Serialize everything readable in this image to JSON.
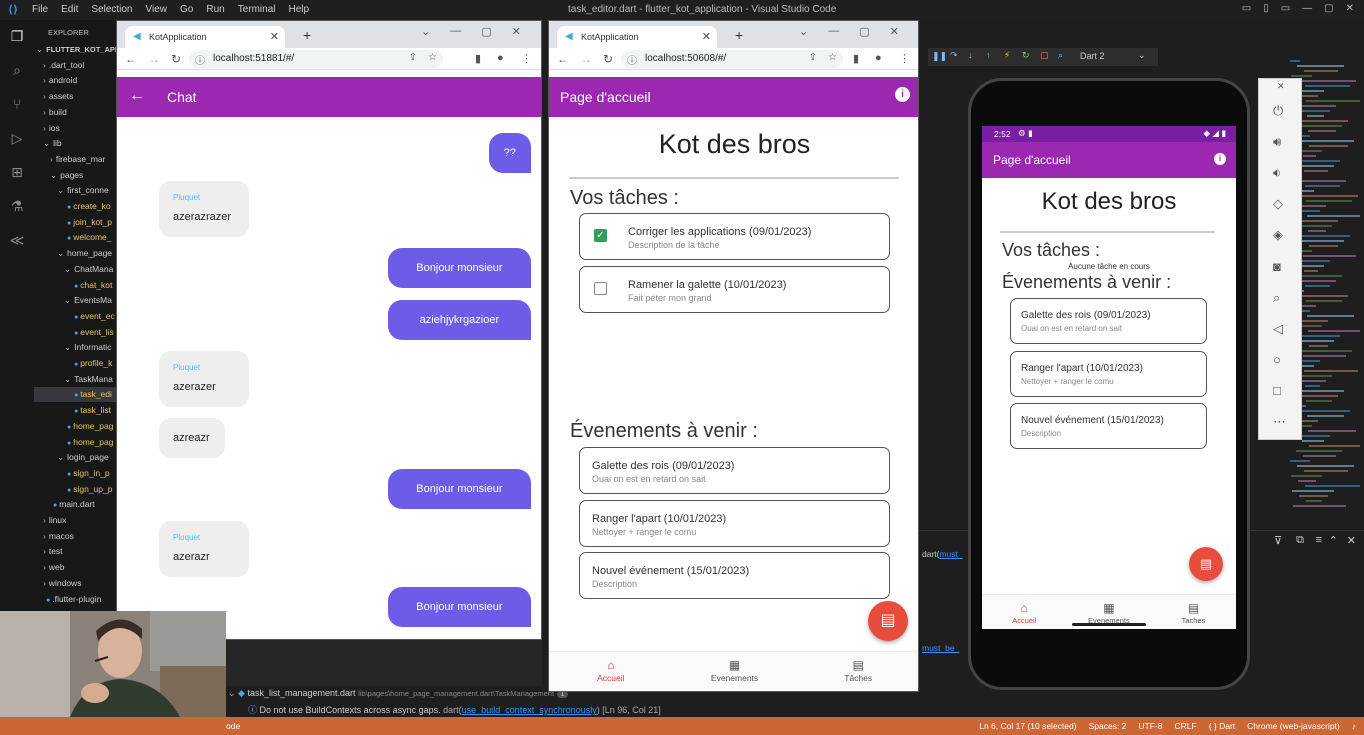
{
  "vscode": {
    "menu": [
      "File",
      "Edit",
      "Selection",
      "View",
      "Go",
      "Run",
      "Terminal",
      "Help"
    ],
    "window_title": "task_editor.dart - flutter_kot_application - Visual Studio Code",
    "explorer_header": "EXPLORER",
    "tree": [
      {
        "label": "FLUTTER_KOT_APP...",
        "depth": 0,
        "arrow": "⌄"
      },
      {
        "label": ".dart_tool",
        "depth": 1,
        "arrow": "›"
      },
      {
        "label": "android",
        "depth": 1,
        "arrow": "›"
      },
      {
        "label": "assets",
        "depth": 1,
        "arrow": "›"
      },
      {
        "label": "build",
        "depth": 1,
        "arrow": "›"
      },
      {
        "label": "ios",
        "depth": 1,
        "arrow": "›"
      },
      {
        "label": "lib",
        "depth": 1,
        "arrow": "⌄"
      },
      {
        "label": "firebase_mar",
        "depth": 2,
        "arrow": "›"
      },
      {
        "label": "pages",
        "depth": 2,
        "arrow": "⌄"
      },
      {
        "label": "first_conne",
        "depth": 3,
        "arrow": "⌄"
      },
      {
        "label": "create_ko",
        "depth": 4,
        "arrow": ""
      },
      {
        "label": "join_kot_p",
        "depth": 4,
        "arrow": ""
      },
      {
        "label": "welcome_",
        "depth": 4,
        "arrow": ""
      },
      {
        "label": "home_page",
        "depth": 3,
        "arrow": "⌄"
      },
      {
        "label": "ChatMana",
        "depth": 4,
        "arrow": "⌄"
      },
      {
        "label": "chat_kot",
        "depth": 5,
        "arrow": ""
      },
      {
        "label": "EventsMa",
        "depth": 4,
        "arrow": "⌄"
      },
      {
        "label": "event_ec",
        "depth": 5,
        "arrow": ""
      },
      {
        "label": "event_lis",
        "depth": 5,
        "arrow": ""
      },
      {
        "label": "Informatic",
        "depth": 4,
        "arrow": "⌄"
      },
      {
        "label": "profile_k",
        "depth": 5,
        "arrow": ""
      },
      {
        "label": "TaskMana",
        "depth": 4,
        "arrow": "⌄"
      },
      {
        "label": "task_edi",
        "depth": 5,
        "arrow": "",
        "selected": true
      },
      {
        "label": "task_list",
        "depth": 5,
        "arrow": ""
      },
      {
        "label": "home_pag",
        "depth": 4,
        "arrow": ""
      },
      {
        "label": "home_pag",
        "depth": 4,
        "arrow": ""
      },
      {
        "label": "login_page",
        "depth": 3,
        "arrow": "⌄"
      },
      {
        "label": "sign_in_p",
        "depth": 4,
        "arrow": ""
      },
      {
        "label": "sign_up_p",
        "depth": 4,
        "arrow": ""
      },
      {
        "label": "main.dart",
        "depth": 2,
        "arrow": ""
      },
      {
        "label": "linux",
        "depth": 1,
        "arrow": "›"
      },
      {
        "label": "macos",
        "depth": 1,
        "arrow": "›"
      },
      {
        "label": "test",
        "depth": 1,
        "arrow": "›"
      },
      {
        "label": "web",
        "depth": 1,
        "arrow": "›"
      },
      {
        "label": "windows",
        "depth": 1,
        "arrow": "›"
      },
      {
        "label": ".flutter-plugin",
        "depth": 1,
        "arrow": ""
      }
    ],
    "debug_device": "Dart 2",
    "problems_file": "task_list_management.dart",
    "problems_path": "lib\\pages\\home_page_management.dart\\TaskManagement",
    "problems_count": "1",
    "problem_msg": "Do not use BuildContexts across async gaps.",
    "problem_src": "dart(",
    "problem_link": "use_build_context_synchronously",
    "problem_pos": ") [Ln 96, Col 21]",
    "panel_snip1": "dart(",
    "panel_snip1_link": "must_",
    "panel_snip2_link": "must_be_",
    "status_left": "ode",
    "status_items": [
      "Ln 6, Col 17 (10 selected)",
      "Spaces: 2",
      "UTF-8",
      "CRLF",
      "{ } Dart",
      "Chrome (web-javascript)"
    ]
  },
  "browser1": {
    "tab_title": "KotApplication",
    "url": "localhost:51881/#/",
    "appbar_title": "Chat",
    "messages": [
      {
        "side": "right",
        "text": "??"
      },
      {
        "side": "left",
        "name": "Pluquet",
        "text": "azerazrazer"
      },
      {
        "side": "right",
        "text": "Bonjour monsieur"
      },
      {
        "side": "right",
        "text": "aziehjykrgazioer"
      },
      {
        "side": "left",
        "name": "Pluquet",
        "text": "azerazer"
      },
      {
        "side": "left",
        "name": "",
        "text": "azreazr"
      },
      {
        "side": "right",
        "text": "Bonjour monsieur"
      },
      {
        "side": "left",
        "name": "Pluquet",
        "text": "azerazr"
      },
      {
        "side": "right",
        "text": "Bonjour monsieur"
      }
    ]
  },
  "browser2": {
    "tab_title": "KotApplication",
    "url": "localhost:50608/#/",
    "appbar_title": "Page d'accueil",
    "kot_name": "Kot des bros",
    "tasks_heading": "Vos tâches :",
    "tasks": [
      {
        "title": "Corriger les applications (09/01/2023)",
        "desc": "Description de la tâche",
        "checked": true
      },
      {
        "title": "Ramener la galette (10/01/2023)",
        "desc": "Fait péter mon grand",
        "checked": false
      }
    ],
    "events_heading": "Évenements à venir :",
    "events": [
      {
        "title": "Galette des rois (09/01/2023)",
        "desc": "Ouai on est en retard on sait"
      },
      {
        "title": "Ranger l'apart (10/01/2023)",
        "desc": "Nettoyer + ranger le comu"
      },
      {
        "title": "Nouvel événement (15/01/2023)",
        "desc": "Description"
      }
    ],
    "nav": [
      "Accueil",
      "Evenements",
      "Tâches"
    ]
  },
  "phone": {
    "time": "2:52",
    "appbar_title": "Page d'accueil",
    "kot_name": "Kot des bros",
    "tasks_heading": "Vos tâches :",
    "no_task": "Aucune tâche en cours",
    "events_heading": "Évenements à venir :",
    "events": [
      {
        "title": "Galette des rois (09/01/2023)",
        "desc": "Ouai on est en retard on sait"
      },
      {
        "title": "Ranger l'apart (10/01/2023)",
        "desc": "Nettoyer + ranger le comu"
      },
      {
        "title": "Nouvel événement (15/01/2023)",
        "desc": "Description"
      }
    ],
    "nav": [
      "Accueil",
      "Evenements",
      "Taches"
    ]
  },
  "colors": {
    "appbar": "#9c27b0",
    "bubble_right": "#6c5ce7",
    "fab": "#e74c3c",
    "status": "#cc6633"
  },
  "icons": {
    "info": "info-icon",
    "chat": "chat-icon",
    "home": "home-icon",
    "calendar": "calendar-icon",
    "task": "task-icon",
    "back": "arrow-back-icon"
  }
}
